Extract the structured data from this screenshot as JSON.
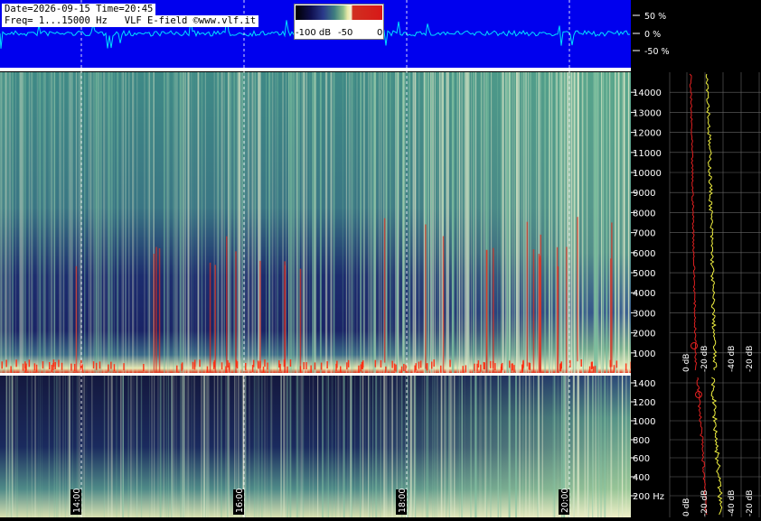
{
  "header": {
    "line1": "Date=2026-09-15 Time=20:45",
    "line2": "Freq= 1...15000 Hz   VLF E-field ©www.vlf.it"
  },
  "colorbar": {
    "labels": [
      "-100 dB",
      "-50",
      "0"
    ]
  },
  "waveform": {
    "labels": [
      "50 %",
      "0 %",
      "-50 %"
    ],
    "background": "#0000ee",
    "trace_color": "#00e0ff"
  },
  "chart_data": [
    {
      "type": "heatmap",
      "panel": "spectrogram-full-range",
      "y_ticks": [
        1000,
        2000,
        3000,
        4000,
        5000,
        6000,
        7000,
        8000,
        9000,
        10000,
        11000,
        12000,
        13000,
        14000
      ],
      "ylim": [
        1,
        15000
      ],
      "x_time_ticks": [
        "14:00",
        "16:00",
        "18:00",
        "20:00"
      ],
      "side_db_labels": [
        "0 dB",
        "-20 dB",
        "-40 dB",
        "-20 dB"
      ],
      "colors": {
        "low": "#1a2266",
        "mid": "#4f9a88",
        "high": "#f0f0c8",
        "peak": "#dd2211"
      }
    },
    {
      "type": "heatmap",
      "panel": "spectrogram-low-range",
      "y_ticks": [
        "200 Hz",
        "400",
        "600",
        "800",
        "1000",
        "1200",
        "1400"
      ],
      "x_time_ticks": [
        "14:00",
        "16:00",
        "18:00",
        "20:00"
      ],
      "side_db_labels": [
        "0 dB",
        "-20 dB",
        "-40 dB",
        "-20 dB"
      ]
    }
  ]
}
